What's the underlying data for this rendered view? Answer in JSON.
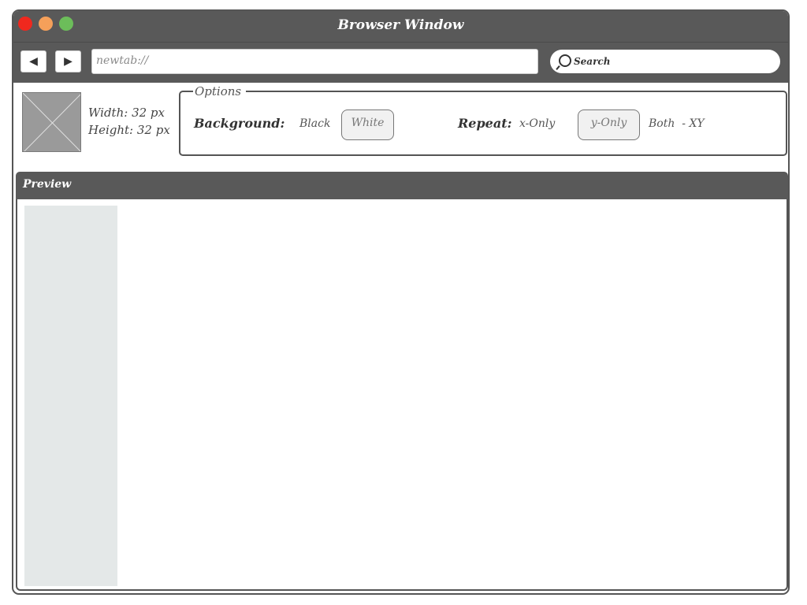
{
  "window": {
    "title": "Browser Window"
  },
  "toolbar": {
    "back_label": "◀",
    "forward_label": "▶",
    "address": "newtab://",
    "search_label": "Search"
  },
  "image_info": {
    "width_label": "Width: 32 px",
    "height_label": "Height: 32 px"
  },
  "options": {
    "legend": "Options",
    "background_label": "Background:",
    "background_choices": [
      "Black",
      "White"
    ],
    "background_selected": "White",
    "repeat_label": "Repeat:",
    "repeat_choices": [
      "x-Only",
      "y-Only",
      "Both  - XY"
    ],
    "repeat_selected": "y-Only"
  },
  "preview": {
    "title": "Preview"
  },
  "colors": {
    "chrome": "#595959",
    "close": "#f0281e",
    "minimize": "#f5a05a",
    "maximize": "#6cbd5a",
    "preview_strip": "#e4e8e8"
  }
}
